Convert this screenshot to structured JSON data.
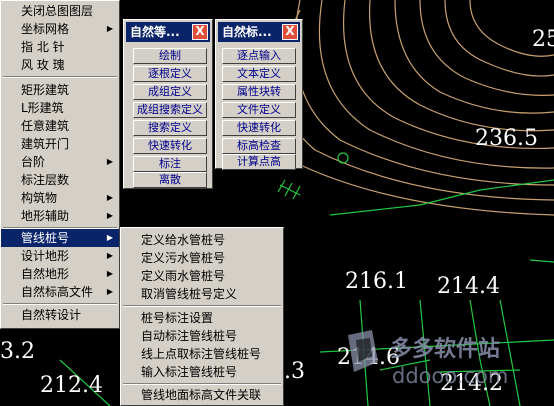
{
  "colors": {
    "background": "#000000",
    "contour": "#c8a070",
    "green": "#22c840",
    "title_bar": "#0a246a",
    "menu_bg": "#d4d0c8",
    "highlight": "#0a246a"
  },
  "main_menu": {
    "items": [
      {
        "label": "关闭总图图层",
        "arrow": ""
      },
      {
        "label": "坐标网格",
        "arrow": "▶"
      },
      {
        "label": "指 北 针",
        "arrow": ""
      },
      {
        "label": "风 玫 瑰",
        "arrow": ""
      },
      {
        "label": "矩形建筑",
        "arrow": ""
      },
      {
        "label": "L形建筑",
        "arrow": ""
      },
      {
        "label": "任意建筑",
        "arrow": ""
      },
      {
        "label": "建筑开门",
        "arrow": ""
      },
      {
        "label": "台阶",
        "arrow": "▶"
      },
      {
        "label": "标注层数",
        "arrow": ""
      },
      {
        "label": "构筑物",
        "arrow": "▶"
      },
      {
        "label": "地形辅助",
        "arrow": "▶"
      },
      {
        "label": "管线桩号",
        "arrow": "▶"
      },
      {
        "label": "设计地形",
        "arrow": "▶"
      },
      {
        "label": "自然地形",
        "arrow": "▶"
      },
      {
        "label": "自然标高文件",
        "arrow": "▶"
      },
      {
        "label": "自然转设计",
        "arrow": ""
      }
    ]
  },
  "submenu": {
    "items": [
      {
        "label": "定义给水管桩号"
      },
      {
        "label": "定义污水管桩号"
      },
      {
        "label": "定义雨水管桩号"
      },
      {
        "label": "取消管线桩号定义"
      },
      {
        "label": "桩号标注设置"
      },
      {
        "label": "自动标注管线桩号"
      },
      {
        "label": "线上点取标注管线桩号"
      },
      {
        "label": "输入标注管线桩号"
      },
      {
        "label": "管线地面标高文件关联"
      }
    ]
  },
  "palette1": {
    "title": "自然等...",
    "close": "X",
    "buttons": [
      "绘制",
      "逐根定义",
      "成组定义",
      "成组搜索定义",
      "搜索定义",
      "快速转化",
      "标注",
      "离散"
    ]
  },
  "palette2": {
    "title": "自然标...",
    "close": "X",
    "buttons": [
      "逐点输入",
      "文本定义",
      "属性块转",
      "文件定义",
      "快速转化",
      "标高检查",
      "计算点高"
    ]
  },
  "canvas_labels": [
    {
      "text": "236.5",
      "color": "#ffffff"
    },
    {
      "text": "216.1",
      "color": "#ffffff"
    },
    {
      "text": "214.4",
      "color": "#ffffff"
    },
    {
      "text": "214.6",
      "color": "#ffffff"
    },
    {
      "text": "214.2",
      "color": "#ffffff"
    },
    {
      "text": "212.4",
      "color": "#ffffff"
    },
    {
      "text": "3.2",
      "color": "#ffffff"
    },
    {
      "text": ".3",
      "color": "#ffffff"
    },
    {
      "text": "25",
      "color": "#ffffff"
    }
  ],
  "watermark": {
    "text": "多多软件站",
    "subtext": "ddooo.com"
  }
}
